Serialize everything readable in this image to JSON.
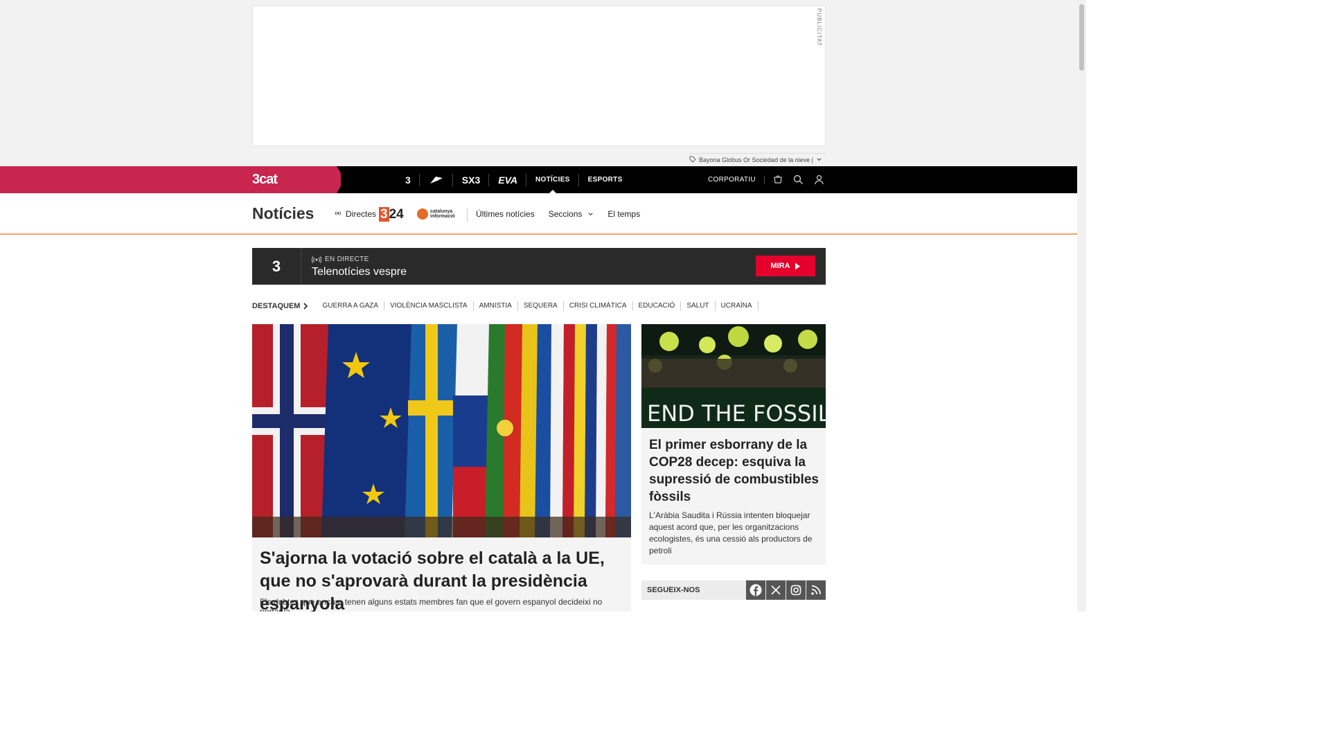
{
  "ad": {
    "label": "PUBLICITAT",
    "tag_text": "Bayona Globus Or Sociedad de la nieve |"
  },
  "topbar": {
    "brand": "3cat",
    "channels": [
      {
        "name": "3",
        "kind": "logo"
      },
      {
        "name": "Cat Ràdio",
        "kind": "logo"
      },
      {
        "name": "SX3",
        "kind": "logo"
      },
      {
        "name": "EVA",
        "kind": "logo"
      },
      {
        "name": "NOTÍCIES",
        "kind": "text",
        "active": true
      },
      {
        "name": "ESPORTS",
        "kind": "text"
      }
    ],
    "corporate": "CORPORATIU",
    "icons": [
      "cart-icon",
      "search-icon",
      "user-icon"
    ]
  },
  "section": {
    "title": "Notícies",
    "directes": "Directes",
    "logo_324": "324",
    "logo_cat_line1": "catalunya",
    "logo_cat_line2": "informació",
    "nav": {
      "latest": "Últimes notícies",
      "sections": "Seccions",
      "weather": "El temps"
    }
  },
  "live": {
    "channel": "3",
    "status": "EN DIRECTE",
    "program": "Telenotícies vespre",
    "button": "MIRA"
  },
  "destaquem": {
    "label": "DESTAQUEM",
    "tags": [
      "GUERRA A GAZA",
      "VIOLÈNCIA MASCLISTA",
      "AMNISTIA",
      "SEQUERA",
      "CRISI CLIMÀTICA",
      "EDUCACIÓ",
      "SALUT",
      "UCRAÏNA"
    ]
  },
  "main_article": {
    "title": "S'ajorna la votació sobre el català a la UE, que no s'aprovarà durant la presidència espanyola",
    "summary": "Els dubtes que encara tenen alguns estats membres fan que el govern espanyol decideixi no portar la"
  },
  "side_article": {
    "title": "El primer esborrany de la COP28 decep: esquiva la supressió de combustibles fòssils",
    "summary": "L'Aràbia Saudita i Rússia intenten bloquejar aquest acord que, per les organitzacions ecologistes, és una cessió als productors de petroli",
    "banner_text": "END THE FOSSIL ERA"
  },
  "follow": {
    "label": "SEGUEIX-NOS",
    "networks": [
      "facebook-icon",
      "x-icon",
      "instagram-icon",
      "rss-icon"
    ]
  }
}
